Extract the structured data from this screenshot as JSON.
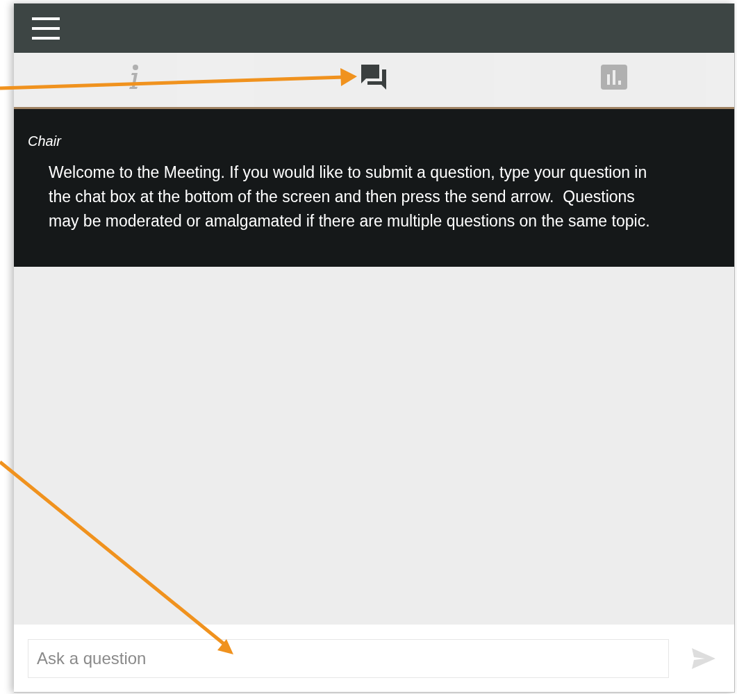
{
  "tabs": [
    {
      "kind": "info",
      "selected": false
    },
    {
      "kind": "chat",
      "selected": true
    },
    {
      "kind": "stats",
      "selected": false
    }
  ],
  "messages": [
    {
      "sender": "Chair",
      "text": "Welcome to the Meeting. If you would like to submit a question, type your question in the chat box at the bottom of the screen and then press the send arrow.  Questions may be moderated or amalgamated if there are multiple questions on the same topic."
    }
  ],
  "question_input": {
    "placeholder": "Ask a question"
  }
}
